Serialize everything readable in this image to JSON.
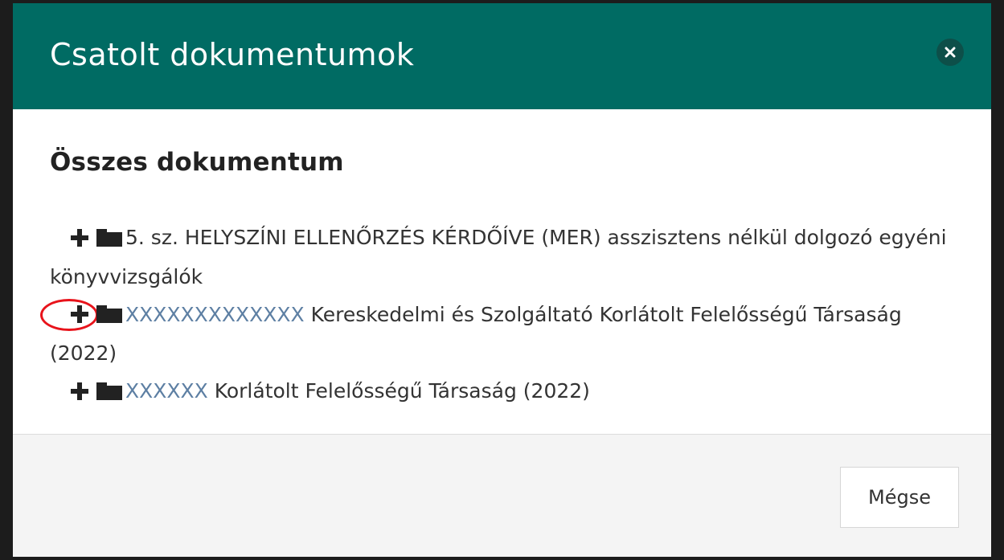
{
  "modal": {
    "title": "Csatolt dokumentumok",
    "close_icon": "close-icon",
    "colors": {
      "header_bg": "#006b63",
      "link": "#5d7fa3",
      "highlight": "#e8131b"
    }
  },
  "body": {
    "section_title": "Összes dokumentum",
    "tree": [
      {
        "expand_icon": "plus-icon",
        "folder_icon": "folder-icon",
        "link_text": "",
        "text": "5. sz. HELYSZÍNI ELLENŐRZÉS KÉRDŐÍVE (MER) asszisztens nélkül dolgozó egyéni könyvvizsgálók"
      },
      {
        "expand_icon": "plus-icon",
        "folder_icon": "folder-icon",
        "link_text": "XXXXXXXXXXXXX",
        "text": " Kereskedelmi és Szolgáltató Korlátolt Felelősségű Társaság (2022)"
      },
      {
        "expand_icon": "plus-icon",
        "folder_icon": "folder-icon",
        "link_text": "XXXXXX",
        "text": " Korlátolt Felelősségű Társaság (2022)"
      }
    ]
  },
  "footer": {
    "cancel_label": "Mégse"
  }
}
